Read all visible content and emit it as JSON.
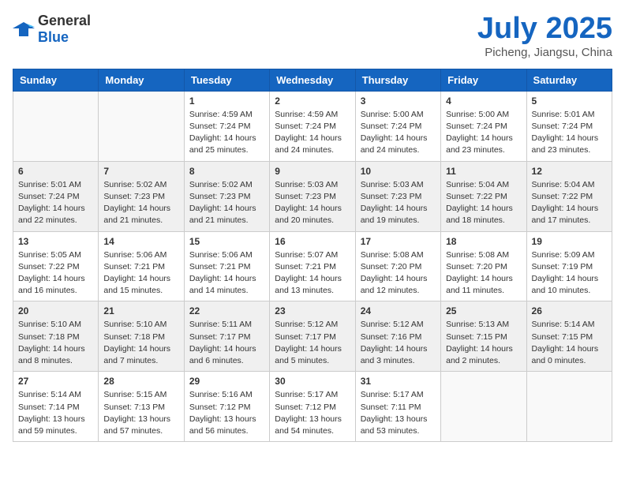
{
  "header": {
    "logo": {
      "general": "General",
      "blue": "Blue"
    },
    "title": "July 2025",
    "location": "Picheng, Jiangsu, China"
  },
  "weekdays": [
    "Sunday",
    "Monday",
    "Tuesday",
    "Wednesday",
    "Thursday",
    "Friday",
    "Saturday"
  ],
  "weeks": [
    [
      {
        "day": "",
        "empty": true
      },
      {
        "day": "",
        "empty": true
      },
      {
        "day": "1",
        "sunrise": "Sunrise: 4:59 AM",
        "sunset": "Sunset: 7:24 PM",
        "daylight": "Daylight: 14 hours and 25 minutes."
      },
      {
        "day": "2",
        "sunrise": "Sunrise: 4:59 AM",
        "sunset": "Sunset: 7:24 PM",
        "daylight": "Daylight: 14 hours and 24 minutes."
      },
      {
        "day": "3",
        "sunrise": "Sunrise: 5:00 AM",
        "sunset": "Sunset: 7:24 PM",
        "daylight": "Daylight: 14 hours and 24 minutes."
      },
      {
        "day": "4",
        "sunrise": "Sunrise: 5:00 AM",
        "sunset": "Sunset: 7:24 PM",
        "daylight": "Daylight: 14 hours and 23 minutes."
      },
      {
        "day": "5",
        "sunrise": "Sunrise: 5:01 AM",
        "sunset": "Sunset: 7:24 PM",
        "daylight": "Daylight: 14 hours and 23 minutes."
      }
    ],
    [
      {
        "day": "6",
        "sunrise": "Sunrise: 5:01 AM",
        "sunset": "Sunset: 7:24 PM",
        "daylight": "Daylight: 14 hours and 22 minutes."
      },
      {
        "day": "7",
        "sunrise": "Sunrise: 5:02 AM",
        "sunset": "Sunset: 7:23 PM",
        "daylight": "Daylight: 14 hours and 21 minutes."
      },
      {
        "day": "8",
        "sunrise": "Sunrise: 5:02 AM",
        "sunset": "Sunset: 7:23 PM",
        "daylight": "Daylight: 14 hours and 21 minutes."
      },
      {
        "day": "9",
        "sunrise": "Sunrise: 5:03 AM",
        "sunset": "Sunset: 7:23 PM",
        "daylight": "Daylight: 14 hours and 20 minutes."
      },
      {
        "day": "10",
        "sunrise": "Sunrise: 5:03 AM",
        "sunset": "Sunset: 7:23 PM",
        "daylight": "Daylight: 14 hours and 19 minutes."
      },
      {
        "day": "11",
        "sunrise": "Sunrise: 5:04 AM",
        "sunset": "Sunset: 7:22 PM",
        "daylight": "Daylight: 14 hours and 18 minutes."
      },
      {
        "day": "12",
        "sunrise": "Sunrise: 5:04 AM",
        "sunset": "Sunset: 7:22 PM",
        "daylight": "Daylight: 14 hours and 17 minutes."
      }
    ],
    [
      {
        "day": "13",
        "sunrise": "Sunrise: 5:05 AM",
        "sunset": "Sunset: 7:22 PM",
        "daylight": "Daylight: 14 hours and 16 minutes."
      },
      {
        "day": "14",
        "sunrise": "Sunrise: 5:06 AM",
        "sunset": "Sunset: 7:21 PM",
        "daylight": "Daylight: 14 hours and 15 minutes."
      },
      {
        "day": "15",
        "sunrise": "Sunrise: 5:06 AM",
        "sunset": "Sunset: 7:21 PM",
        "daylight": "Daylight: 14 hours and 14 minutes."
      },
      {
        "day": "16",
        "sunrise": "Sunrise: 5:07 AM",
        "sunset": "Sunset: 7:21 PM",
        "daylight": "Daylight: 14 hours and 13 minutes."
      },
      {
        "day": "17",
        "sunrise": "Sunrise: 5:08 AM",
        "sunset": "Sunset: 7:20 PM",
        "daylight": "Daylight: 14 hours and 12 minutes."
      },
      {
        "day": "18",
        "sunrise": "Sunrise: 5:08 AM",
        "sunset": "Sunset: 7:20 PM",
        "daylight": "Daylight: 14 hours and 11 minutes."
      },
      {
        "day": "19",
        "sunrise": "Sunrise: 5:09 AM",
        "sunset": "Sunset: 7:19 PM",
        "daylight": "Daylight: 14 hours and 10 minutes."
      }
    ],
    [
      {
        "day": "20",
        "sunrise": "Sunrise: 5:10 AM",
        "sunset": "Sunset: 7:18 PM",
        "daylight": "Daylight: 14 hours and 8 minutes."
      },
      {
        "day": "21",
        "sunrise": "Sunrise: 5:10 AM",
        "sunset": "Sunset: 7:18 PM",
        "daylight": "Daylight: 14 hours and 7 minutes."
      },
      {
        "day": "22",
        "sunrise": "Sunrise: 5:11 AM",
        "sunset": "Sunset: 7:17 PM",
        "daylight": "Daylight: 14 hours and 6 minutes."
      },
      {
        "day": "23",
        "sunrise": "Sunrise: 5:12 AM",
        "sunset": "Sunset: 7:17 PM",
        "daylight": "Daylight: 14 hours and 5 minutes."
      },
      {
        "day": "24",
        "sunrise": "Sunrise: 5:12 AM",
        "sunset": "Sunset: 7:16 PM",
        "daylight": "Daylight: 14 hours and 3 minutes."
      },
      {
        "day": "25",
        "sunrise": "Sunrise: 5:13 AM",
        "sunset": "Sunset: 7:15 PM",
        "daylight": "Daylight: 14 hours and 2 minutes."
      },
      {
        "day": "26",
        "sunrise": "Sunrise: 5:14 AM",
        "sunset": "Sunset: 7:15 PM",
        "daylight": "Daylight: 14 hours and 0 minutes."
      }
    ],
    [
      {
        "day": "27",
        "sunrise": "Sunrise: 5:14 AM",
        "sunset": "Sunset: 7:14 PM",
        "daylight": "Daylight: 13 hours and 59 minutes."
      },
      {
        "day": "28",
        "sunrise": "Sunrise: 5:15 AM",
        "sunset": "Sunset: 7:13 PM",
        "daylight": "Daylight: 13 hours and 57 minutes."
      },
      {
        "day": "29",
        "sunrise": "Sunrise: 5:16 AM",
        "sunset": "Sunset: 7:12 PM",
        "daylight": "Daylight: 13 hours and 56 minutes."
      },
      {
        "day": "30",
        "sunrise": "Sunrise: 5:17 AM",
        "sunset": "Sunset: 7:12 PM",
        "daylight": "Daylight: 13 hours and 54 minutes."
      },
      {
        "day": "31",
        "sunrise": "Sunrise: 5:17 AM",
        "sunset": "Sunset: 7:11 PM",
        "daylight": "Daylight: 13 hours and 53 minutes."
      },
      {
        "day": "",
        "empty": true
      },
      {
        "day": "",
        "empty": true
      }
    ]
  ]
}
